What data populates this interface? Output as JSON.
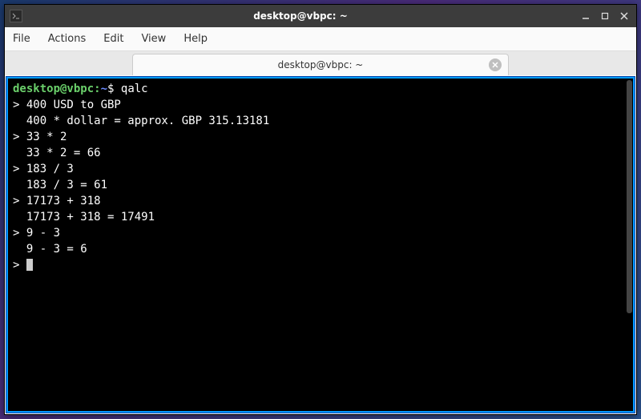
{
  "window": {
    "title": "desktop@vbpc: ~"
  },
  "menubar": {
    "file": "File",
    "actions": "Actions",
    "edit": "Edit",
    "view": "View",
    "help": "Help"
  },
  "tab": {
    "label": "desktop@vbpc: ~"
  },
  "prompt": {
    "user_host": "desktop@vbpc",
    "colon": ":",
    "path": "~",
    "dollar": "$ ",
    "command": "qalc"
  },
  "lines": {
    "l0": "> 400 USD to GBP",
    "l1": "",
    "l2": "  400 * dollar = approx. GBP 315.13181",
    "l3": "",
    "l4": "> 33 * 2",
    "l5": "",
    "l6": "  33 * 2 = 66",
    "l7": "",
    "l8": "> 183 / 3",
    "l9": "",
    "l10": "  183 / 3 = 61",
    "l11": "",
    "l12": "> 17173 + 318",
    "l13": "",
    "l14": "  17173 + 318 = 17491",
    "l15": "",
    "l16": "> 9 - 3",
    "l17": "",
    "l18": "  9 - 3 = 6",
    "l19": "",
    "l20": "> "
  }
}
